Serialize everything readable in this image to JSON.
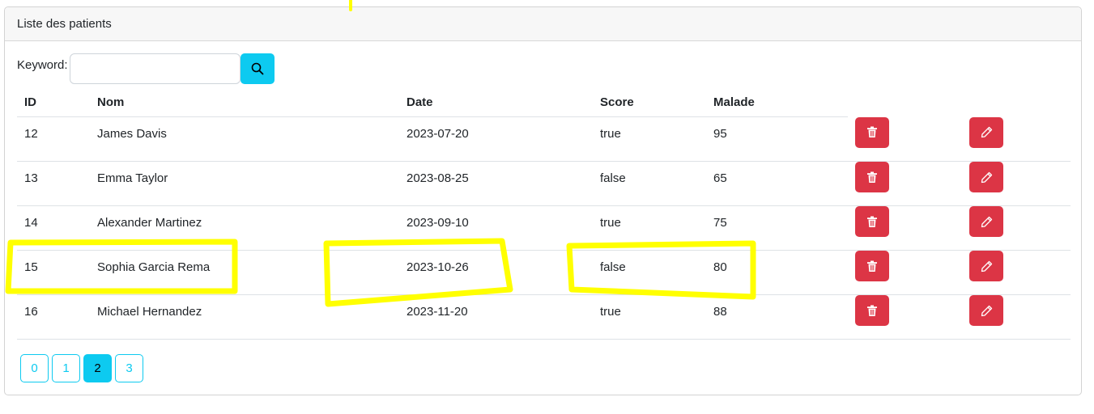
{
  "card": {
    "title": "Liste des patients"
  },
  "search": {
    "label": "Keyword:",
    "value": "",
    "placeholder": "",
    "button_icon": "search-icon"
  },
  "table": {
    "headers": [
      "ID",
      "Nom",
      "Date",
      "Score",
      "Malade"
    ],
    "rows": [
      {
        "id": "12",
        "nom": "James Davis",
        "date": "2023-07-20",
        "score": "true",
        "malade": "95"
      },
      {
        "id": "13",
        "nom": "Emma Taylor",
        "date": "2023-08-25",
        "score": "false",
        "malade": "65"
      },
      {
        "id": "14",
        "nom": "Alexander Martinez",
        "date": "2023-09-10",
        "score": "true",
        "malade": "75"
      },
      {
        "id": "15",
        "nom": "Sophia Garcia Rema",
        "date": "2023-10-26",
        "score": "false",
        "malade": "80"
      },
      {
        "id": "16",
        "nom": "Michael Hernandez",
        "date": "2023-11-20",
        "score": "true",
        "malade": "88"
      }
    ],
    "delete_icon": "trash-icon",
    "edit_icon": "pencil-icon"
  },
  "pagination": {
    "pages": [
      "0",
      "1",
      "2",
      "3"
    ],
    "current": "2"
  },
  "colors": {
    "info": "#0dcaf0",
    "danger": "#dc3545",
    "highlight": "#ffff00"
  }
}
